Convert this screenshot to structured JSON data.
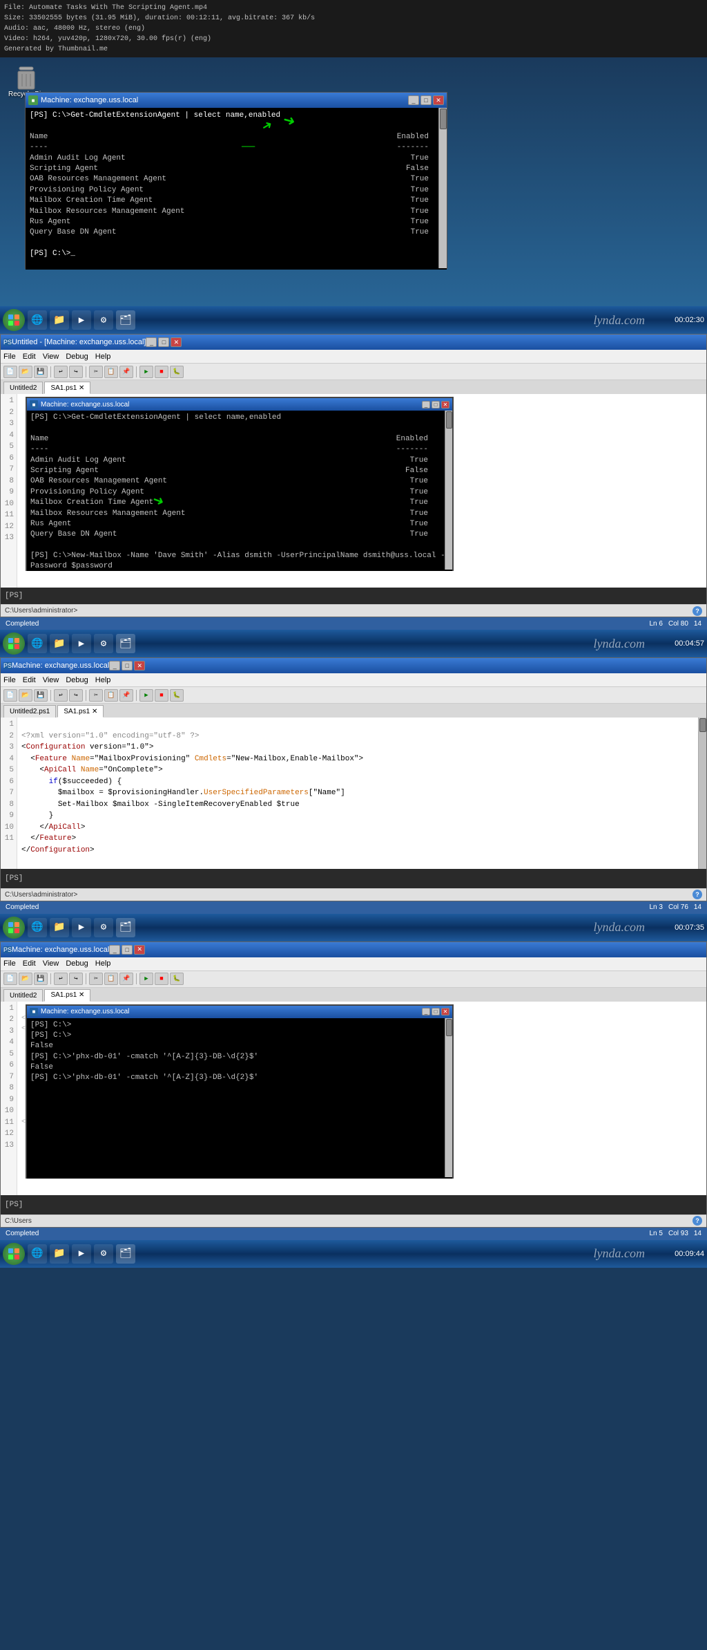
{
  "fileInfo": {
    "line1": "File: Automate Tasks With The Scripting Agent.mp4",
    "line2": "Size: 33502555 bytes (31.95 MiB), duration: 00:12:11, avg.bitrate: 367 kb/s",
    "line3": "Audio: aac, 48000 Hz, stereo (eng)",
    "line4": "Video: h264, yuv420p, 1280x720, 30.00 fps(r) (eng)",
    "line5": "Generated by Thumbnail.me"
  },
  "section1": {
    "windowTitle": "Machine: exchange.uss.local",
    "terminal": {
      "cmd1": "[PS] C:\\>Get-CmdletExtensionAgent | select name,enabled",
      "col_name": "Name",
      "col_enabled": "Enabled",
      "sep1": "----",
      "sep2": "-------",
      "agents": [
        {
          "name": "Admin Audit Log Agent",
          "enabled": "True"
        },
        {
          "name": "Scripting Agent",
          "enabled": "False"
        },
        {
          "name": "OAB Resources Management Agent",
          "enabled": "True"
        },
        {
          "name": "Provisioning Policy Agent",
          "enabled": "True"
        },
        {
          "name": "Mailbox Creation Time Agent",
          "enabled": "True"
        },
        {
          "name": "Mailbox Resources Management Agent",
          "enabled": "True"
        },
        {
          "name": "Rus Agent",
          "enabled": "True"
        },
        {
          "name": "Query Base DN Agent",
          "enabled": "True"
        }
      ],
      "prompt": "[PS] C:\\>_"
    },
    "taskbar": {
      "time": "00:02:30",
      "lynda": "lynda.com"
    }
  },
  "section2": {
    "ideTitle": "Machine: exchange.uss.local",
    "outerIdeTitle": "Untitled - [Machine: exchange.uss.local]",
    "menuItems": [
      "File",
      "Edit",
      "View",
      "Debug",
      "Help"
    ],
    "tabs": [
      "Untitled2",
      "SA1.ps1"
    ],
    "innerTerminal": {
      "title": "Machine: exchange.uss.local",
      "lines": [
        "[PS] C:\\>Get-CmdletExtensionAgent | select name,enabled",
        "",
        "Name                                   Enabled",
        "----                                   -------",
        "Admin Audit Log Agent                    True",
        "Scripting Agent                          False",
        "OAB Resources Management Agent           True",
        "Provisioning Policy Agent                True",
        "Mailbox Creation Time Agent              True",
        "Mailbox Resources Management Agent       True",
        "Rus Agent                                True",
        "Query Base DN Agent                      True",
        "",
        "[PS] C:\\>New-Mailbox -Name 'Dave Smith' -Alias dsmith -UserPrincipalName dsmith@uss.local -Password $password"
      ],
      "prompt": "[PS]"
    },
    "statusBar": {
      "left": "Completed",
      "ln": "Ln 6",
      "col": "Col 80",
      "right": "14"
    },
    "taskbar": {
      "time": "00:04:57",
      "lynda": "lynda.com"
    }
  },
  "section3": {
    "ideTitle": "Machine: exchange.uss.local",
    "tabs": [
      "Untitled2.ps1",
      "SA1.ps1"
    ],
    "activeTab": "SA1.ps1",
    "lineNumbers": [
      "1",
      "2",
      "3",
      "4",
      "5",
      "6",
      "7",
      "8",
      "9",
      "10",
      "11"
    ],
    "codeLines": [
      "<?xml version=\"1.0\" encoding=\"utf-8\" ?>",
      "<Configuration version=\"1.0\">",
      "  <Feature Name=\"MailboxProvisioning\" Cmdlets=\"New-Mailbox,Enable-Mailbox\">",
      "    <ApiCall Name=\"OnComplete\">",
      "      if($succeeded) {",
      "        $mailbox = $provisioningHandler.UserSpecifiedParameters[\"Name\"]",
      "        Set-Mailbox $mailbox -SingleItemRecoveryEnabled $true",
      "      }",
      "    </ApiCall>",
      "  </Feature>",
      "</Configuration>"
    ],
    "outputPanel": "[PS]",
    "pathBar": "C:\\Users\\administrator>",
    "statusBar": {
      "left": "Completed",
      "ln": "Ln 3",
      "col": "Col 76",
      "right": "14"
    },
    "taskbar": {
      "time": "00:07:35",
      "lynda": "lynda.com"
    }
  },
  "section4": {
    "ideTitle": "Machine: exchange.uss.local",
    "tabs": [
      "Untitled2",
      "SA1.ps1"
    ],
    "innerTerminal": {
      "title": "Machine: exchange.uss.local",
      "lines": [
        "[PS] C:\\>",
        "[PS] C:\\>",
        "False",
        "[PS] C:\\>'phx-db-01' -cmatch '^[A-Z]{3}-DB-\\d{2}$'",
        "False",
        "[PS] C:\\>'phx-db-01' -cmatch '^[A-Z]{3}-DB-\\d{2}$'"
      ]
    },
    "outputPanel": "[PS]",
    "pathBar": "C:\\Users",
    "statusBar": {
      "left": "Completed",
      "ln": "Ln 5",
      "col": "Col 93",
      "right": "14"
    },
    "taskbar": {
      "time": "00:09:44",
      "lynda": "lynda.com"
    }
  },
  "icons": {
    "minimize": "_",
    "maximize": "□",
    "close": "✕",
    "start": "⊞",
    "folder": "📁",
    "ie": "🌐",
    "media": "▶",
    "settings": "⚙"
  }
}
